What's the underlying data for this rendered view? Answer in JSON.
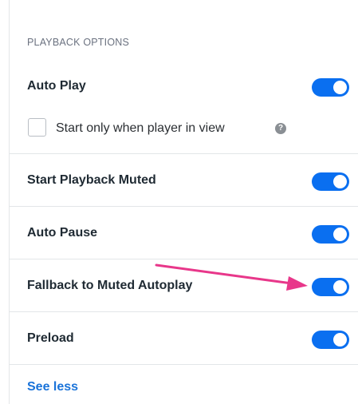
{
  "section": {
    "title": "PLAYBACK OPTIONS"
  },
  "settings": [
    {
      "label": "Auto Play",
      "enabled": true
    },
    {
      "label": "Start Playback Muted",
      "enabled": true
    },
    {
      "label": "Auto Pause",
      "enabled": true
    },
    {
      "label": "Fallback to Muted Autoplay",
      "enabled": true
    },
    {
      "label": "Preload",
      "enabled": true
    }
  ],
  "checkbox": {
    "label": "Start only when player in view",
    "checked": false,
    "help_icon": "?"
  },
  "footer": {
    "see_less": "See less"
  },
  "colors": {
    "toggle_on": "#0a6ff0",
    "arrow": "#e8378a",
    "link": "#1a73d9"
  }
}
